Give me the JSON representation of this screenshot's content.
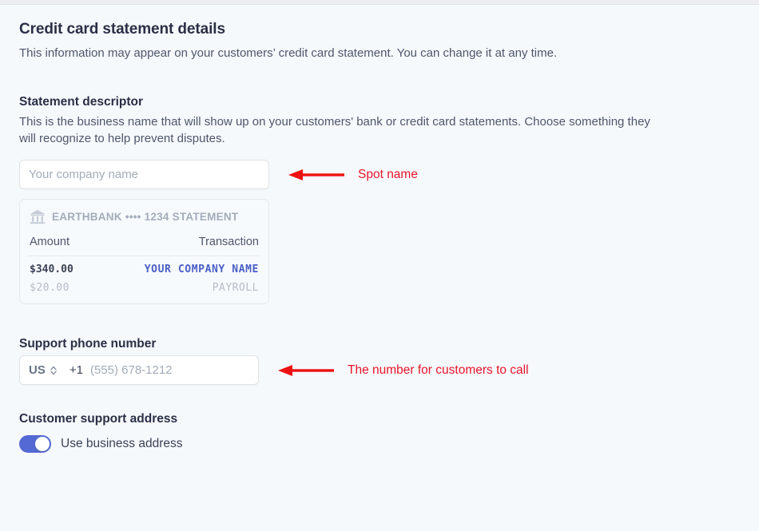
{
  "section": {
    "title": "Credit card statement details",
    "description": "This information may appear on your customers’ credit card statement. You can change it at any time."
  },
  "descriptor": {
    "label": "Statement descriptor",
    "help": "This is the business name that will show up on your customers' bank or credit card statements. Choose something they will recognize to help prevent disputes.",
    "input_placeholder": "Your company name",
    "input_value": "",
    "annotation": "Spot name"
  },
  "statement_preview": {
    "bank_header": "EARTHBANK •••• 1234 STATEMENT",
    "columns": {
      "amount": "Amount",
      "transaction": "Transaction"
    },
    "rows": [
      {
        "amount": "$340.00",
        "transaction": "YOUR COMPANY NAME",
        "style": "highlight"
      },
      {
        "amount": "$20.00",
        "transaction": "PAYROLL",
        "style": "muted"
      }
    ]
  },
  "phone": {
    "label": "Support phone number",
    "country": "US",
    "dial_code": "+1",
    "placeholder": "(555) 678-1212",
    "value": "",
    "annotation": "The number for customers to call"
  },
  "address": {
    "label": "Customer support address",
    "toggle_label": "Use business address",
    "toggle_on": true
  },
  "colors": {
    "accent": "#5469d4",
    "annotation_red": "#e8152a",
    "statement_blue": "#4a5ec7",
    "page_background": "#f6f9fc"
  }
}
